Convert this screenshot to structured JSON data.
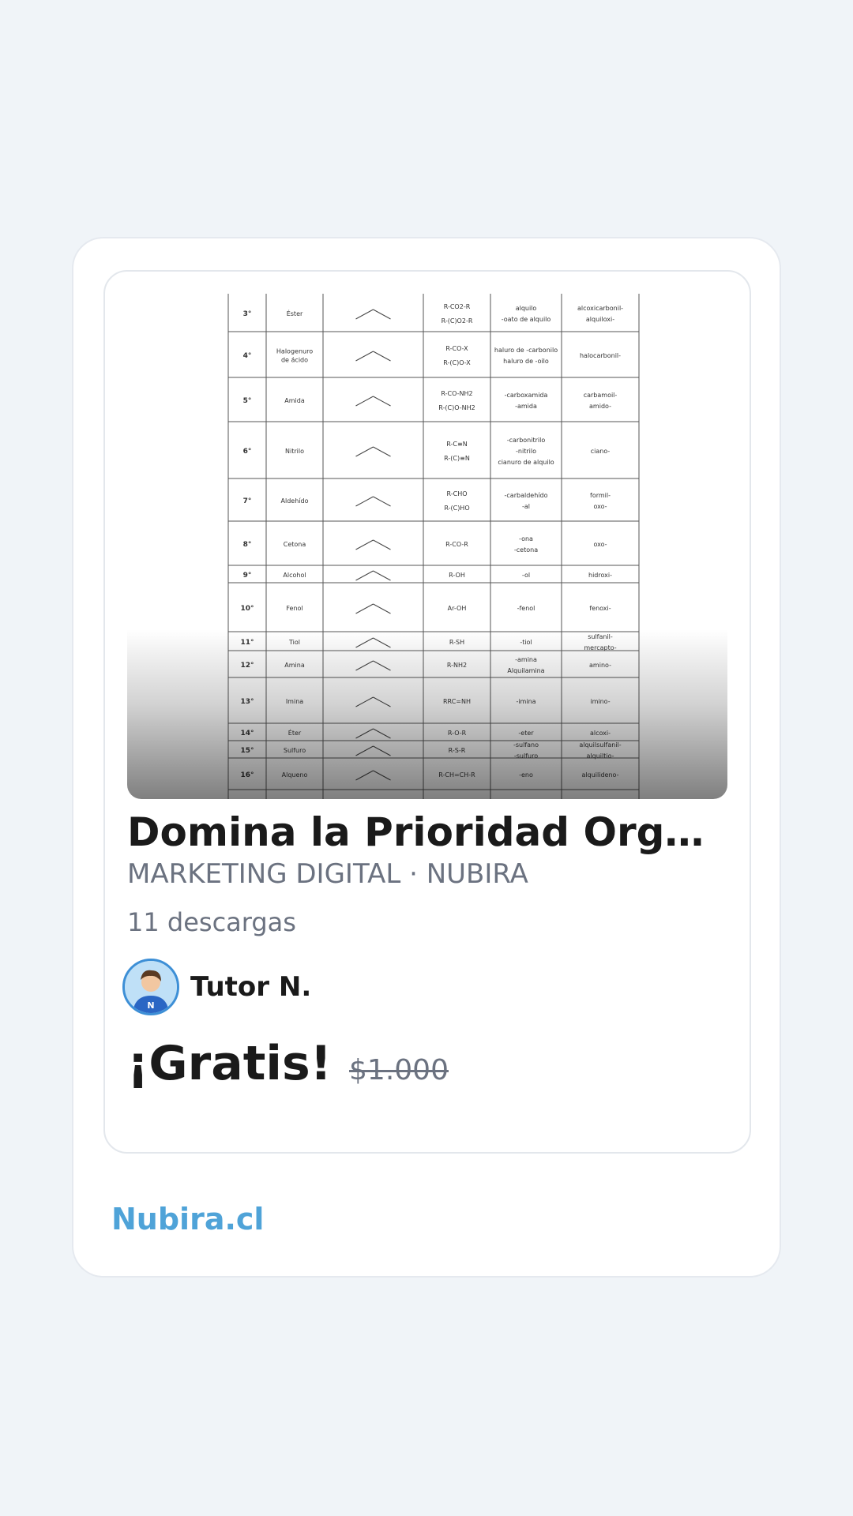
{
  "product": {
    "title": "Domina la Prioridad Orgánica...",
    "category": "MARKETING DIGITAL · NUBIRA",
    "downloads": "11 descargas",
    "author_name": "Tutor N.",
    "price": "¡Gratis!",
    "old_price": "$1.000",
    "image": {
      "semantic": "organic-functional-group-priority-table",
      "rows": [
        {
          "n": "3°",
          "name": "Éster",
          "formula": [
            "R-CO2-R",
            "R-(C)O2-R"
          ],
          "suffix": [
            "alquilo",
            "-oato de alquilo"
          ],
          "prefix": [
            "alcoxicarbonil-",
            "alquiloxi-"
          ]
        },
        {
          "n": "4°",
          "name": "Halogenuro de ácido",
          "formula": [
            "R-CO-X",
            "R-(C)O-X"
          ],
          "suffix": [
            "haluro de -carbonilo",
            "haluro de -oilo"
          ],
          "prefix": [
            "halocarbonil-"
          ]
        },
        {
          "n": "5°",
          "name": "Amida",
          "formula": [
            "R-CO-NH2",
            "R-(C)O-NH2"
          ],
          "suffix": [
            "-carboxamida",
            "-amida"
          ],
          "prefix": [
            "carbamoil-",
            "amido-"
          ]
        },
        {
          "n": "6°",
          "name": "Nitrilo",
          "formula": [
            "R-C≡N",
            "R-(C)≡N"
          ],
          "suffix": [
            "-carbonitrilo",
            "-nitrilo",
            "cianuro de alquilo"
          ],
          "prefix": [
            "ciano-"
          ]
        },
        {
          "n": "7°",
          "name": "Aldehído",
          "formula": [
            "R-CHO",
            "R-(C)HO"
          ],
          "suffix": [
            "-carbaldehído",
            "-al"
          ],
          "prefix": [
            "formil-",
            "oxo-"
          ]
        },
        {
          "n": "8°",
          "name": "Cetona",
          "formula": [
            "R-CO-R"
          ],
          "suffix": [
            "-ona",
            "-cetona"
          ],
          "prefix": [
            "oxo-"
          ]
        },
        {
          "n": "9°",
          "name": "Alcohol",
          "formula": [
            "R-OH"
          ],
          "suffix": [
            "-ol"
          ],
          "prefix": [
            "hidroxi-"
          ]
        },
        {
          "n": "10°",
          "name": "Fenol",
          "formula": [
            "Ar-OH"
          ],
          "suffix": [
            "-fenol"
          ],
          "prefix": [
            "fenoxi-"
          ]
        },
        {
          "n": "11°",
          "name": "Tiol",
          "formula": [
            "R-SH"
          ],
          "suffix": [
            "-tiol"
          ],
          "prefix": [
            "sulfanil-",
            "mercapto-"
          ]
        },
        {
          "n": "12°",
          "name": "Amina",
          "formula": [
            "R-NH2"
          ],
          "suffix": [
            "-amina",
            "Alquilamina"
          ],
          "prefix": [
            "amino-"
          ]
        },
        {
          "n": "13°",
          "name": "Imina",
          "formula": [
            "RRC=NH"
          ],
          "suffix": [
            "-imina"
          ],
          "prefix": [
            "imino-"
          ]
        },
        {
          "n": "14°",
          "name": "Éter",
          "formula": [
            "R-O-R"
          ],
          "suffix": [
            "-eter"
          ],
          "prefix": [
            "alcoxi-"
          ]
        },
        {
          "n": "15°",
          "name": "Sulfuro",
          "formula": [
            "R-S-R"
          ],
          "suffix": [
            "-sulfano",
            "-sulfuro"
          ],
          "prefix": [
            "alquilsulfanil-",
            "alquiltio-"
          ]
        },
        {
          "n": "16°",
          "name": "Alqueno",
          "formula": [
            "R-CH=CH-R"
          ],
          "suffix": [
            "-eno"
          ],
          "prefix": [
            "alquilideno-"
          ]
        }
      ]
    }
  },
  "footer": {
    "brand": "Nubira.cl"
  },
  "colors": {
    "background": "#f0f4f8",
    "brand": "#4fa3d8",
    "muted": "#6b7280",
    "text": "#1a1a1a"
  },
  "icons": {
    "avatar": "tutor-avatar-icon"
  }
}
